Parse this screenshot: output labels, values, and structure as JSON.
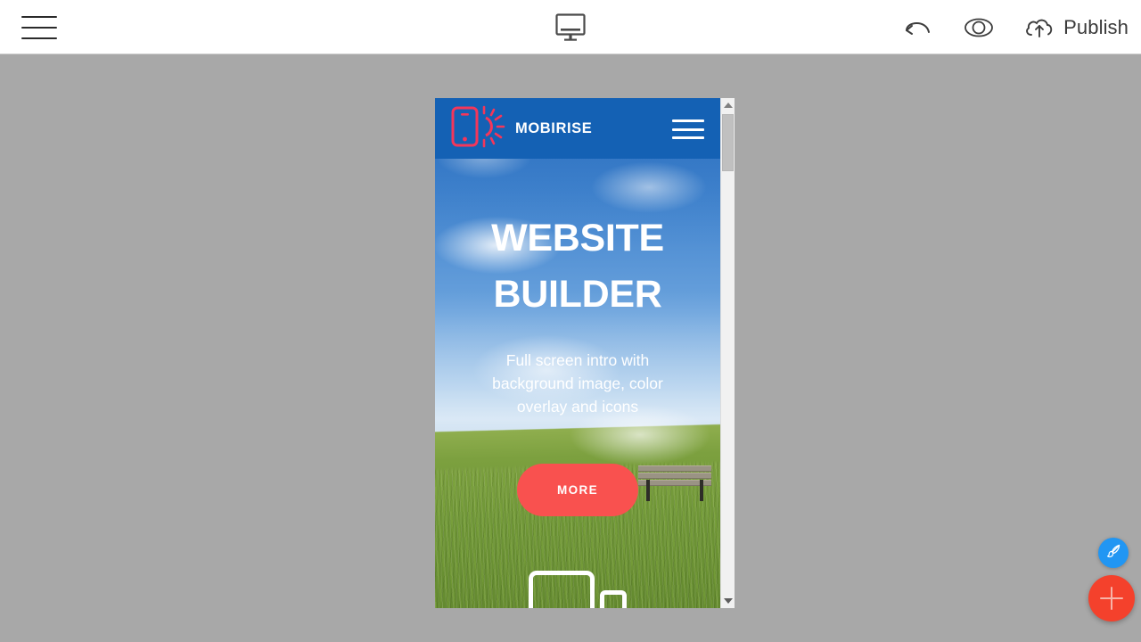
{
  "toolbar": {
    "menu_icon": "hamburger-menu-icon",
    "device_icon": "desktop-monitor-icon",
    "undo_icon": "undo-arrow-icon",
    "preview_icon": "eye-preview-icon",
    "publish_icon": "cloud-upload-icon",
    "publish_label": "Publish"
  },
  "preview": {
    "navbar": {
      "logo_icon": "mobirise-phone-sun-logo-icon",
      "brand": "MOBIRISE",
      "menu_icon": "hamburger-menu-icon"
    },
    "hero": {
      "title_line1": "WEBSITE",
      "title_line2": "BUILDER",
      "subtitle": "Full screen intro with background image, color overlay and icons",
      "cta_label": "MORE",
      "device_icons": [
        "tablet-outline-icon",
        "phone-outline-icon"
      ]
    },
    "scrollbar": {
      "up_arrow": "scroll-up-arrow-icon",
      "down_arrow": "scroll-down-arrow-icon"
    }
  },
  "floating": {
    "style_icon": "paintbrush-icon",
    "add_icon": "plus-icon"
  },
  "colors": {
    "workspace_bg": "#a8a8a8",
    "toolbar_bg": "#ffffff",
    "navbar_blue": "#1461b4",
    "cta_red": "#f9514f",
    "logo_red": "#f4365a",
    "fab_blue": "#2196f3",
    "fab_red": "#f4412c"
  }
}
